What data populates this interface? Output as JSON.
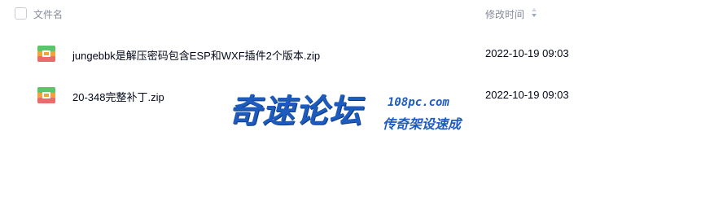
{
  "header": {
    "name_label": "文件名",
    "time_label": "修改时间"
  },
  "files": [
    {
      "name": "jungebbk是解压密码包含ESP和WXF插件2个版本.zip",
      "modified": "2022-10-19 09:03",
      "icon": "zip-archive-icon"
    },
    {
      "name": "20-348完整补丁.zip",
      "modified": "2022-10-19 09:03",
      "icon": "zip-archive-icon"
    }
  ],
  "watermark": {
    "main": "奇速论坛",
    "url": "108pc.com",
    "sub": "传奇架设速成"
  },
  "colors": {
    "header_text": "#878c9c",
    "row_text": "#03081a",
    "watermark": "#1e5bbf",
    "zip_green": "#5cc46a",
    "zip_orange": "#f2a23c",
    "zip_pink": "#e96b6b"
  }
}
